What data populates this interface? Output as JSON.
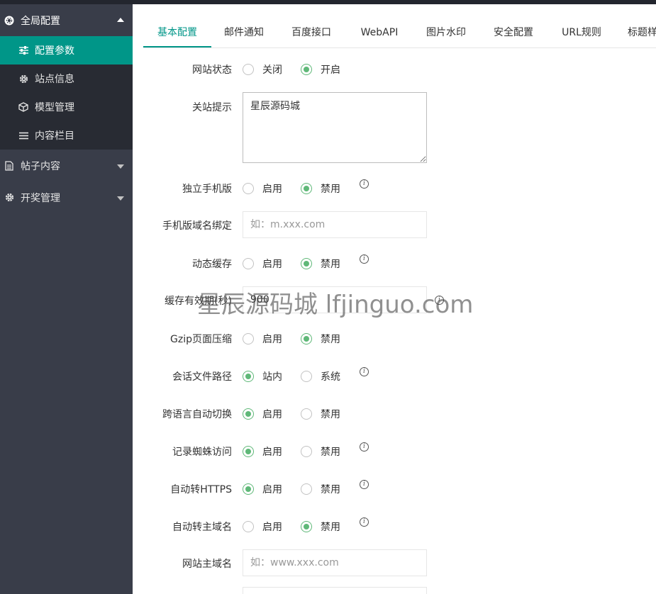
{
  "sidebar": {
    "groups": [
      {
        "label": "全局配置",
        "icon": "gear-circle-icon",
        "expanded": true
      },
      {
        "label": "帖子内容",
        "icon": "document-icon",
        "expanded": false
      },
      {
        "label": "开奖管理",
        "icon": "gear-icon",
        "expanded": false
      }
    ],
    "items": [
      {
        "label": "配置参数",
        "icon": "sliders-icon",
        "active": true
      },
      {
        "label": "站点信息",
        "icon": "gear-icon"
      },
      {
        "label": "模型管理",
        "icon": "cube-icon"
      },
      {
        "label": "内容栏目",
        "icon": "list-icon"
      }
    ]
  },
  "tabs": [
    "基本配置",
    "邮件通知",
    "百度接口",
    "WebAPI",
    "图片水印",
    "安全配置",
    "URL规则",
    "标题样"
  ],
  "form": {
    "site_status": {
      "label": "网站状态",
      "opt1": "关闭",
      "opt2": "开启",
      "selected": 2
    },
    "close_tip": {
      "label": "关站提示",
      "value": "星辰源码城"
    },
    "mobile_site": {
      "label": "独立手机版",
      "opt1": "启用",
      "opt2": "禁用",
      "selected": 2
    },
    "mobile_domain": {
      "label": "手机版域名绑定",
      "placeholder": "如：m.xxx.com"
    },
    "dynamic_cache": {
      "label": "动态缓存",
      "opt1": "启用",
      "opt2": "禁用",
      "selected": 2
    },
    "cache_ttl": {
      "label": "缓存有效期(秒)",
      "value": "900"
    },
    "gzip": {
      "label": "Gzip页面压缩",
      "opt1": "启用",
      "opt2": "禁用",
      "selected": 2
    },
    "session_path": {
      "label": "会话文件路径",
      "opt1": "站内",
      "opt2": "系统",
      "selected": 1
    },
    "lang_switch": {
      "label": "跨语言自动切换",
      "opt1": "启用",
      "opt2": "禁用",
      "selected": 1
    },
    "spider_log": {
      "label": "记录蜘蛛访问",
      "opt1": "启用",
      "opt2": "禁用",
      "selected": 1
    },
    "auto_https": {
      "label": "自动转HTTPS",
      "opt1": "启用",
      "opt2": "禁用",
      "selected": 1
    },
    "auto_main_domain": {
      "label": "自动转主域名",
      "opt1": "启用",
      "opt2": "禁用",
      "selected": 2
    },
    "main_domain": {
      "label": "网站主域名",
      "placeholder": "如：www.xxx.com"
    }
  },
  "watermark": "星辰源码城 lfjinguo.com",
  "colors": {
    "accent": "#009688",
    "radio_checked": "#5fb878",
    "sidebar_bg": "#393d49",
    "subnav_bg": "#282b33"
  }
}
